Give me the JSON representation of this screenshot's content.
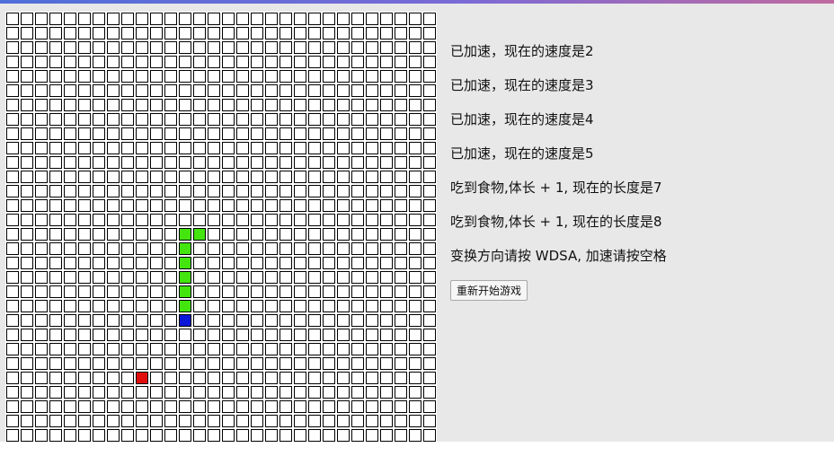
{
  "game": {
    "grid": {
      "columns": 30,
      "rows": 30
    },
    "snake": {
      "head": {
        "col": 12,
        "row": 21,
        "color": "#0a16d8"
      },
      "body": [
        {
          "col": 12,
          "row": 15
        },
        {
          "col": 13,
          "row": 15
        },
        {
          "col": 12,
          "row": 16
        },
        {
          "col": 12,
          "row": 17
        },
        {
          "col": 12,
          "row": 18
        },
        {
          "col": 12,
          "row": 19
        },
        {
          "col": 12,
          "row": 20
        }
      ],
      "body_color": "#44e40f"
    },
    "food": {
      "col": 9,
      "row": 25,
      "color": "#e10d0d"
    },
    "empty_color": "#ffffff",
    "cell_border_color": "#000000"
  },
  "log": {
    "messages": [
      "已加速，现在的速度是2",
      "已加速，现在的速度是3",
      "已加速，现在的速度是4",
      "已加速，现在的速度是5",
      "吃到食物,体长 + 1, 现在的长度是7",
      "吃到食物,体长 + 1, 现在的长度是8",
      "变换方向请按 WDSA, 加速请按空格"
    ]
  },
  "controls": {
    "restart_label": "重新开始游戏"
  },
  "colors": {
    "panel_bg": "#e8e8e8",
    "top_bar_start": "#4f6fd8",
    "top_bar_end": "#c06aa0"
  }
}
